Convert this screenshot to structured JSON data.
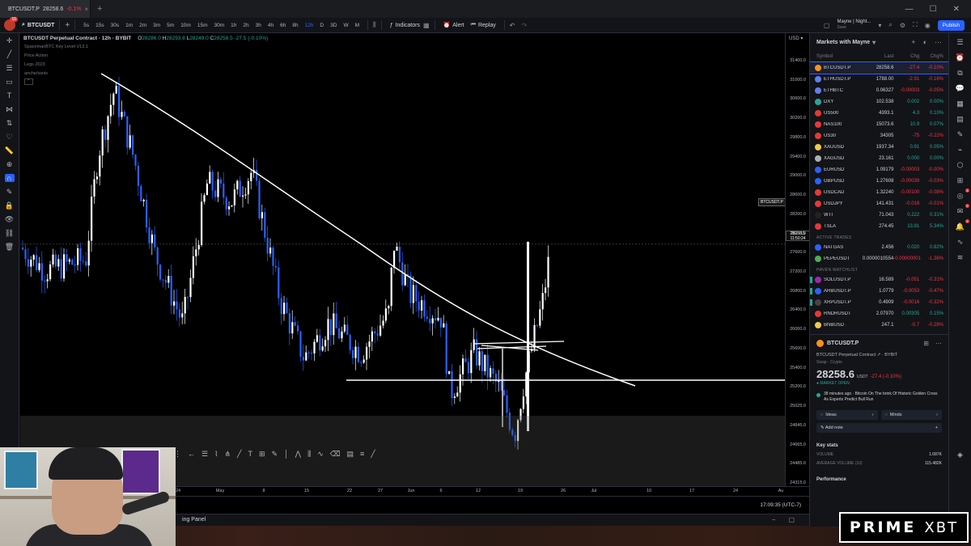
{
  "browser": {
    "tab_symbol": "BTCUSDT.P",
    "tab_price": "28258.6",
    "tab_change": "-0.1%",
    "tab_close": "×",
    "new_tab": "+",
    "minimize": "—",
    "maximize": "☐",
    "close": "✕"
  },
  "toolbar": {
    "notif_count": "15",
    "symbol": "BTCUSDT",
    "add_symbol": "+",
    "intervals": [
      "5s",
      "15s",
      "30s",
      "1m",
      "2m",
      "3m",
      "5m",
      "10m",
      "15m",
      "30m",
      "1h",
      "2h",
      "3h",
      "4h",
      "6h",
      "8h",
      "12h",
      "D",
      "3D",
      "W",
      "M"
    ],
    "active_interval": "12h",
    "indicators_label": "Indicators",
    "alert_label": "Alert",
    "replay_label": "Replay",
    "layout_name": "Mayne | Night...",
    "layout_sub": "Save",
    "publish_label": "Publish"
  },
  "chart": {
    "title": "BTCUSDT Perpetual Contract · 12h · BYBIT",
    "ohlc": {
      "o_label": "O",
      "o": "28286.0",
      "h_label": "H",
      "h": "28293.8",
      "l_label": "L",
      "l": "28249.0",
      "c_label": "C",
      "c": "28258.5",
      "chg": "-27.5 (-0.10%)"
    },
    "indicators": [
      "SpacemanBTC Key Level V13.1",
      "Price Action",
      "Legs 2023",
      "anche/ssnis"
    ],
    "currency": "USD",
    "current_price_tag": "BTCUSDT.P",
    "current_price_axis": "28258.5",
    "countdown": "11:50:24",
    "price_axis": [
      "31400.0",
      "31000.0",
      "30600.0",
      "30200.0",
      "29800.0",
      "29400.0",
      "29000.0",
      "28600.0",
      "28200.0",
      "28000.0",
      "27600.0",
      "27200.0",
      "26800.0",
      "26400.0",
      "26000.0",
      "25600.0",
      "25400.0",
      "25200.0",
      "25025.0",
      "24845.0",
      "24665.0",
      "24485.0",
      "24315.0"
    ],
    "time_axis": [
      "24",
      "May",
      "8",
      "15",
      "22",
      "27",
      "Jun",
      "6",
      "12",
      "19",
      "26",
      "Jul",
      "10",
      "17",
      "24",
      "Au"
    ],
    "clock": "17:09:35 (UTC-7)",
    "panel_label": "ing Panel"
  },
  "chart_data": {
    "type": "candlestick",
    "title": "BTCUSDT Perpetual Contract · 12h · BYBIT",
    "xlabel": "",
    "ylabel": "",
    "ylim": [
      24315,
      31600
    ],
    "x": [
      "24",
      "May",
      "8",
      "15",
      "22",
      "27",
      "Jun",
      "6",
      "12",
      "19"
    ],
    "close": [
      28200,
      29000,
      28100,
      27200,
      26900,
      28400,
      26600,
      25400,
      25000,
      28258.5
    ]
  },
  "watchlist": {
    "title": "Markets with Mayne",
    "columns": [
      "Symbol",
      "Last",
      "Chg",
      "Chg%"
    ],
    "rows": [
      {
        "sym": "BTCUSDT.P",
        "last": "28258.6",
        "chg": "-27.4",
        "chgp": "-0.10%",
        "dir": "dn",
        "color": "#f7931a",
        "sel": true
      },
      {
        "sym": "ETHUSDT.P",
        "last": "1788.00",
        "chg": "-2.91",
        "chgp": "-0.16%",
        "dir": "dn",
        "color": "#627eea"
      },
      {
        "sym": "ETHBTC",
        "last": "0.06327",
        "chg": "-0.00003",
        "chgp": "-0.05%",
        "dir": "dn",
        "color": "#627eea"
      },
      {
        "sym": "DXY",
        "last": "102.538",
        "chg": "0.002",
        "chgp": "0.00%",
        "dir": "up",
        "color": "#26a69a"
      },
      {
        "sym": "US500",
        "last": "4393.1",
        "chg": "4.3",
        "chgp": "0.10%",
        "dir": "up",
        "color": "#e53935"
      },
      {
        "sym": "NAS100",
        "last": "15073.6",
        "chg": "10.9",
        "chgp": "0.07%",
        "dir": "up",
        "color": "#e53935"
      },
      {
        "sym": "US30",
        "last": "34305",
        "chg": "-75",
        "chgp": "-0.22%",
        "dir": "dn",
        "color": "#e53935"
      },
      {
        "sym": "XAUUSD",
        "last": "1937.34",
        "chg": "0.91",
        "chgp": "0.05%",
        "dir": "up",
        "color": "#f2c94c"
      },
      {
        "sym": "XAGUSD",
        "last": "23.161",
        "chg": "0.000",
        "chgp": "0.00%",
        "dir": "up",
        "color": "#b0b0b0"
      },
      {
        "sym": "EURUSD",
        "last": "1.09179",
        "chg": "-0.00003",
        "chgp": "-0.00%",
        "dir": "dn",
        "color": "#2962ff"
      },
      {
        "sym": "GBPUSD",
        "last": "1.27608",
        "chg": "-0.00039",
        "chgp": "-0.03%",
        "dir": "dn",
        "color": "#2962ff"
      },
      {
        "sym": "USDCAD",
        "last": "1.32240",
        "chg": "-0.00100",
        "chgp": "-0.08%",
        "dir": "dn",
        "color": "#e53935"
      },
      {
        "sym": "USDJPY",
        "last": "141.431",
        "chg": "-0.018",
        "chgp": "-0.01%",
        "dir": "dn",
        "color": "#e53935"
      },
      {
        "sym": "WTI",
        "last": "71.043",
        "chg": "0.222",
        "chgp": "0.31%",
        "dir": "up",
        "color": "#222222"
      },
      {
        "sym": "TSLA",
        "last": "274.45",
        "chg": "13.91",
        "chgp": "5.34%",
        "dir": "up",
        "color": "#e53935"
      }
    ],
    "active_title": "ACTIVE TRADES",
    "active_rows": [
      {
        "sym": "NATGAS",
        "last": "2.456",
        "chg": "0.020",
        "chgp": "0.82%",
        "dir": "up",
        "color": "#2962ff"
      },
      {
        "sym": "PEPEUSDT",
        "last": "0.0000010554",
        "chg": "-0.00000001",
        "chgp": "-1.36%",
        "dir": "dn",
        "color": "#4caf50"
      }
    ],
    "haven_title": "HAVEN WATCHLIST",
    "haven_rows": [
      {
        "sym": "SOLUSDT.P",
        "last": "16.589",
        "chg": "-0.051",
        "chgp": "-0.31%",
        "dir": "dn",
        "color": "#9c27b0",
        "flag": true
      },
      {
        "sym": "ARBUSDT.P",
        "last": "1.0779",
        "chg": "-0.0053",
        "chgp": "-0.47%",
        "dir": "dn",
        "color": "#2962ff",
        "flag": true
      },
      {
        "sym": "XRPUSDT.P",
        "last": "0.4909",
        "chg": "-0.0016",
        "chgp": "-0.32%",
        "dir": "dn",
        "color": "#444",
        "flag": true
      },
      {
        "sym": "RNDRUSDT",
        "last": "2.07970",
        "chg": "0.00305",
        "chgp": "0.15%",
        "dir": "up",
        "color": "#e53935"
      },
      {
        "sym": "BNBUSD",
        "last": "247.1",
        "chg": "-0.7",
        "chgp": "-0.28%",
        "dir": "dn",
        "color": "#f2c94c"
      }
    ]
  },
  "detail": {
    "symbol": "BTCUSDT.P",
    "name": "BTCUSDT Perpetual Contract ↗ · BYBIT",
    "sub": "Swap · Crypto",
    "price": "28258.6",
    "currency": "USDT",
    "change": "-27.4 (-0.10%)",
    "status": "● MARKET OPEN",
    "news": "38 minutes ago · Bitcoin On The brink Of Historic Golden Cross As Experts Predict Bull Run",
    "ideas": "Ideas",
    "minds": "Minds",
    "add_note": "Add note",
    "key_stats": "Key stats",
    "volume_label": "VOLUME",
    "volume": "1.087K",
    "avg_volume_label": "AVERAGE VOLUME (10)",
    "avg_volume": "115.482K",
    "performance": "Performance"
  },
  "sponsor": {
    "left": "PRIME",
    "right": "XBT"
  },
  "colors": {
    "up": "#26a69a",
    "down": "#f23645",
    "accent": "#2962ff",
    "candle_up": "#ffffff",
    "candle_down": "#2962ff"
  }
}
